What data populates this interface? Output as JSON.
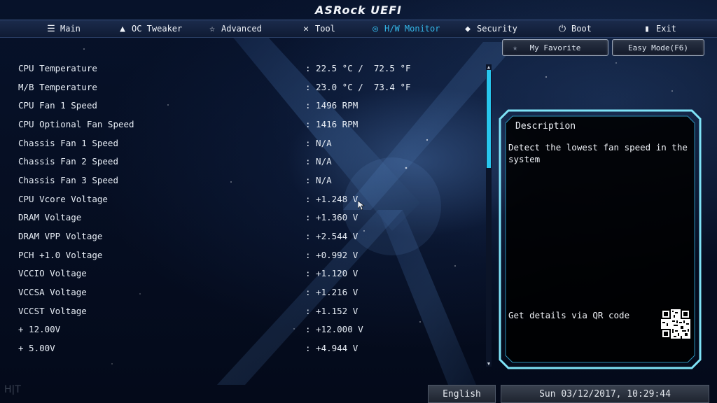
{
  "app": {
    "logo": "ASRock UEFI"
  },
  "nav": [
    {
      "label": "Main",
      "icon": "list-icon",
      "active": false
    },
    {
      "label": "OC Tweaker",
      "icon": "rocket-icon",
      "active": false
    },
    {
      "label": "Advanced",
      "icon": "star-icon",
      "active": false
    },
    {
      "label": "Tool",
      "icon": "tools-icon",
      "active": false
    },
    {
      "label": "H/W Monitor",
      "icon": "monitor-icon",
      "active": true
    },
    {
      "label": "Security",
      "icon": "shield-icon",
      "active": false
    },
    {
      "label": "Boot",
      "icon": "power-icon",
      "active": false
    },
    {
      "label": "Exit",
      "icon": "exit-icon",
      "active": false
    }
  ],
  "buttons": {
    "favorite": "My Favorite",
    "easy_mode": "Easy Mode(F6)"
  },
  "readings": [
    {
      "label": "CPU Temperature",
      "value": ": 22.5 °C /  72.5 °F"
    },
    {
      "label": "M/B Temperature",
      "value": ": 23.0 °C /  73.4 °F"
    },
    {
      "label": "CPU Fan 1 Speed",
      "value": ": 1496 RPM"
    },
    {
      "label": "CPU Optional Fan Speed",
      "value": ": 1416 RPM"
    },
    {
      "label": "Chassis Fan 1 Speed",
      "value": ": N/A"
    },
    {
      "label": "Chassis Fan 2 Speed",
      "value": ": N/A"
    },
    {
      "label": "Chassis Fan 3 Speed",
      "value": ": N/A"
    },
    {
      "label": "CPU Vcore Voltage",
      "value": ": +1.248 V"
    },
    {
      "label": "DRAM Voltage",
      "value": ": +1.360 V"
    },
    {
      "label": "DRAM VPP Voltage",
      "value": ": +2.544 V"
    },
    {
      "label": "PCH +1.0 Voltage",
      "value": ": +0.992 V"
    },
    {
      "label": "VCCIO Voltage",
      "value": ": +1.120 V"
    },
    {
      "label": "VCCSA Voltage",
      "value": ": +1.216 V"
    },
    {
      "label": "VCCST Voltage",
      "value": ": +1.152 V"
    },
    {
      "label": "+ 12.00V",
      "value": ": +12.000 V"
    },
    {
      "label": "+ 5.00V",
      "value": ": +4.944 V"
    }
  ],
  "description": {
    "title": "Description",
    "text": "Detect the lowest fan speed in the system",
    "qr_label": "Get details via QR code"
  },
  "status": {
    "language": "English",
    "datetime": "Sun 03/12/2017, 10:29:44",
    "watermark": "H|T"
  },
  "colors": {
    "accent": "#34b7e8",
    "scroll_thumb": "#28c6ee",
    "frame": "#7fe3f7"
  }
}
